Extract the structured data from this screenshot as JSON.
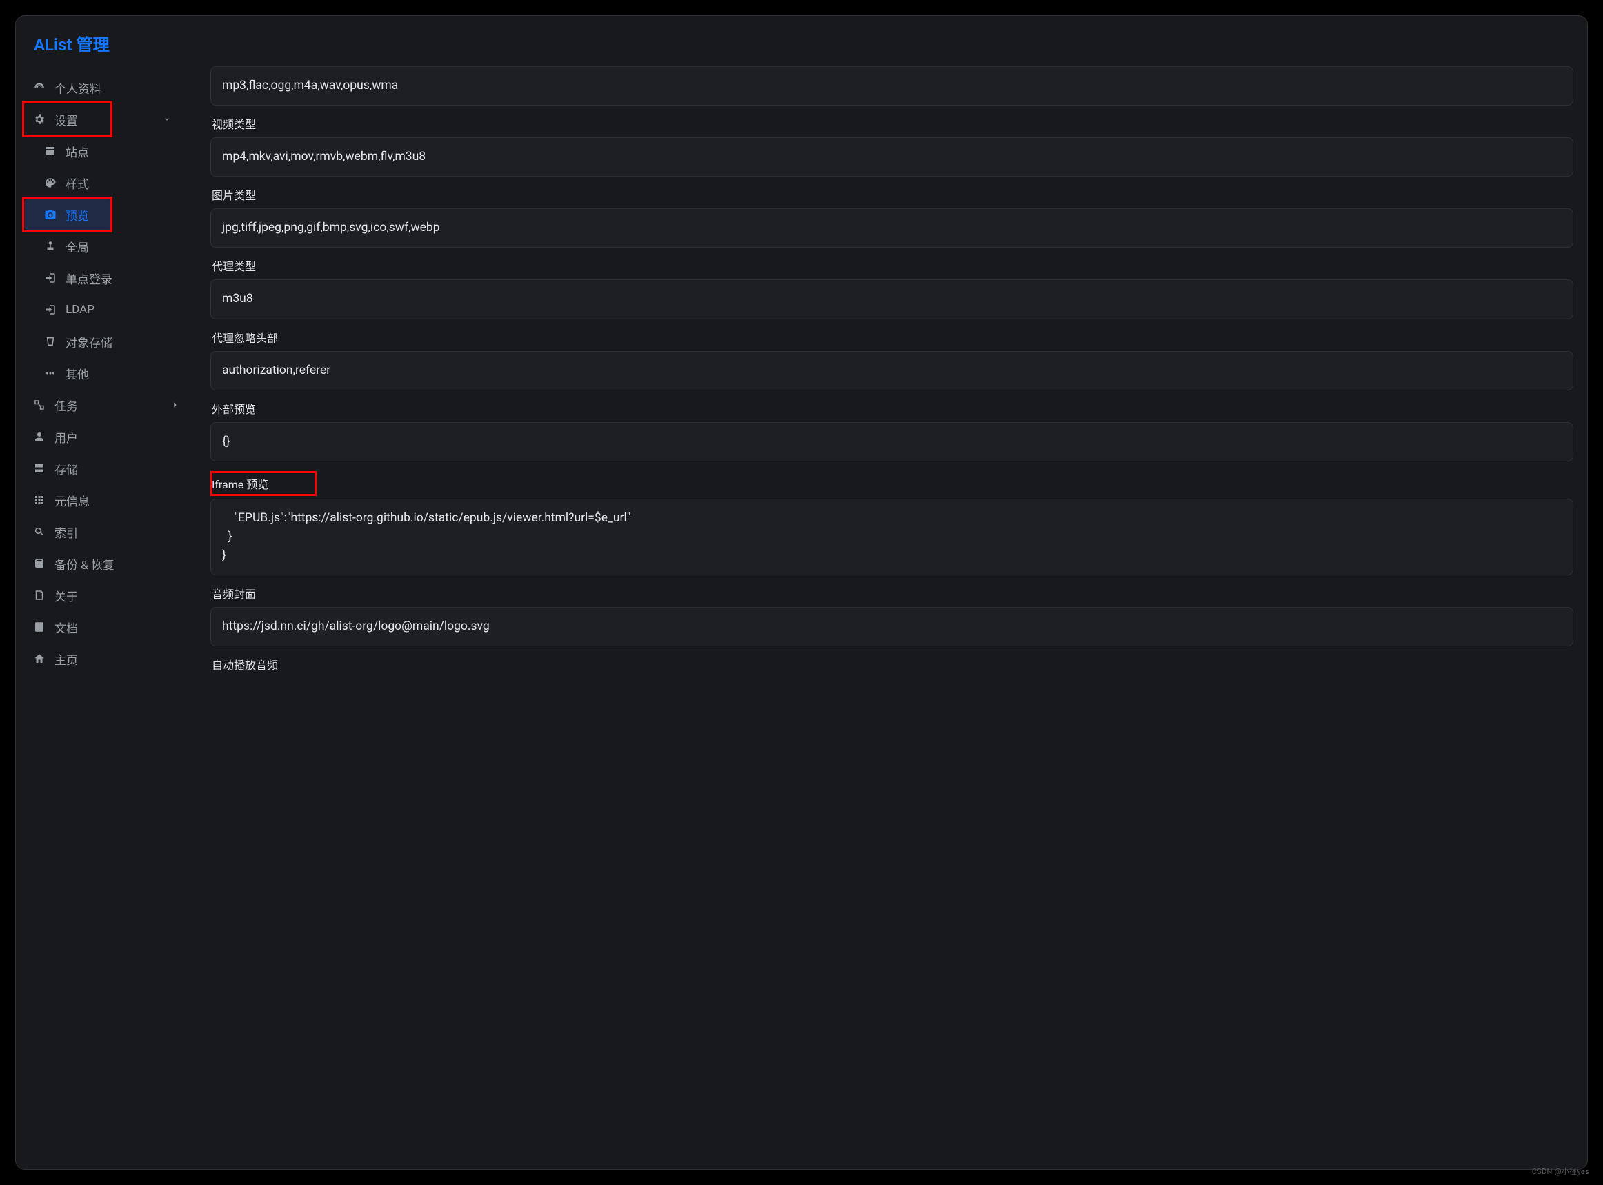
{
  "header": {
    "title": "AList 管理"
  },
  "sidebar": {
    "profile": "个人资料",
    "settings": "设置",
    "settings_children": {
      "site": "站点",
      "style": "样式",
      "preview": "预览",
      "global": "全局",
      "sso": "单点登录",
      "ldap": "LDAP",
      "object_storage": "对象存储",
      "other": "其他"
    },
    "tasks": "任务",
    "users": "用户",
    "storage": "存储",
    "meta": "元信息",
    "index": "索引",
    "backup": "备份 & 恢复",
    "about": "关于",
    "docs": "文档",
    "home": "主页"
  },
  "settings_preview": {
    "audio_types": {
      "label": "",
      "value": "mp3,flac,ogg,m4a,wav,opus,wma"
    },
    "video_types": {
      "label": "视频类型",
      "value": "mp4,mkv,avi,mov,rmvb,webm,flv,m3u8"
    },
    "image_types": {
      "label": "图片类型",
      "value": "jpg,tiff,jpeg,png,gif,bmp,svg,ico,swf,webp"
    },
    "proxy_types": {
      "label": "代理类型",
      "value": "m3u8"
    },
    "proxy_ignore_headers": {
      "label": "代理忽略头部",
      "value": "authorization,referer"
    },
    "external_previews": {
      "label": "外部预览",
      "value": "{}"
    },
    "iframe_previews": {
      "label": "Iframe 预览",
      "value": "    \"EPUB.js\":\"https://alist-org.github.io/static/epub.js/viewer.html?url=$e_url\"\n  }\n}"
    },
    "audio_cover": {
      "label": "音频封面",
      "value": "https://jsd.nn.ci/gh/alist-org/logo@main/logo.svg"
    },
    "audio_autoplay": {
      "label": "自动播放音频"
    }
  },
  "watermark": "CSDN @小径yes"
}
